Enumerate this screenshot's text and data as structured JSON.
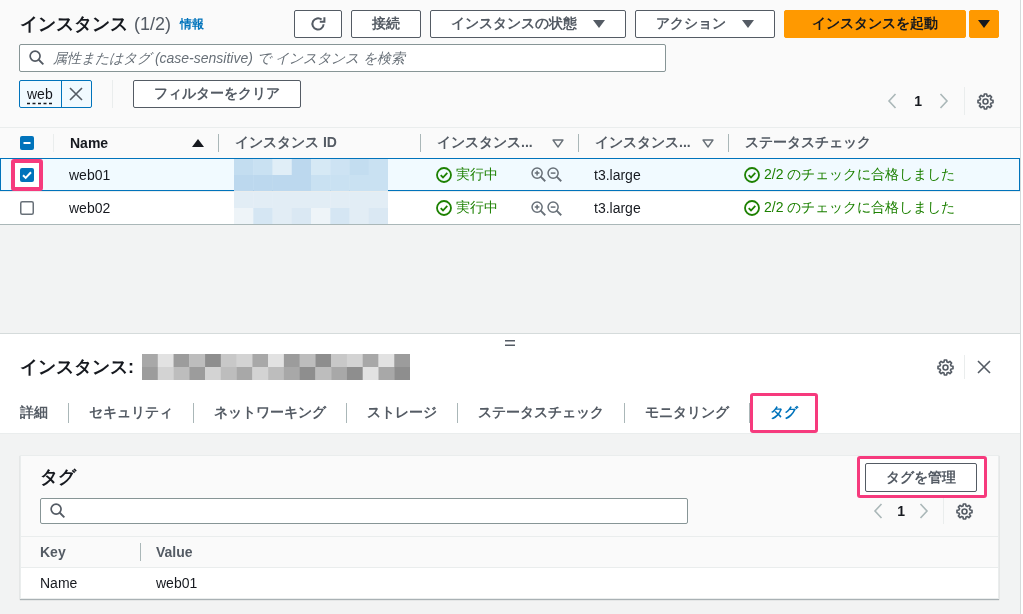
{
  "header": {
    "title": "インスタンス",
    "count": "(1/2)",
    "info_link": "情報"
  },
  "actions": [
    {
      "kind": "refresh"
    },
    {
      "kind": "button",
      "label": "接続"
    },
    {
      "kind": "dropdown",
      "label": "インスタンスの状態"
    },
    {
      "kind": "dropdown",
      "label": "アクション"
    },
    {
      "kind": "primary-split",
      "label": "インスタンスを起動"
    }
  ],
  "search": {
    "placeholder": "属性またはタグ (case-sensitive) で インスタンス を検索"
  },
  "filter_tokens": [
    {
      "label": "web"
    }
  ],
  "clear_filters_button": "フィルターをクリア",
  "pagination": {
    "page": "1"
  },
  "table": {
    "select_all": {
      "checked": false,
      "indeterminate": true
    },
    "columns": [
      {
        "label": "Name",
        "sorted": true,
        "filter": false
      },
      {
        "label": "インスタンス ID",
        "sorted": false,
        "filter": false
      },
      {
        "label": "インスタンス...",
        "sorted": false,
        "filter": true
      },
      {
        "label": "インスタンス...",
        "sorted": false,
        "filter": true
      },
      {
        "label": "ステータスチェック",
        "sorted": false,
        "filter": false
      }
    ],
    "rows": [
      {
        "selected": true,
        "highlighted": true,
        "name": "web01",
        "state": {
          "label": "実行中",
          "kind": "success"
        },
        "type": "t3.large",
        "status_check": {
          "label": "2/2 のチェックに合格しました",
          "kind": "success"
        }
      },
      {
        "selected": false,
        "highlighted": false,
        "name": "web02",
        "state": {
          "label": "実行中",
          "kind": "success"
        },
        "type": "t3.large",
        "status_check": {
          "label": "2/2 のチェックに合格しました",
          "kind": "success"
        }
      }
    ]
  },
  "details": {
    "title": "インスタンス:",
    "tabs": [
      {
        "label": "詳細",
        "selected": false,
        "highlighted": false
      },
      {
        "label": "セキュリティ",
        "selected": false,
        "highlighted": false
      },
      {
        "label": "ネットワーキング",
        "selected": false,
        "highlighted": false
      },
      {
        "label": "ストレージ",
        "selected": false,
        "highlighted": false
      },
      {
        "label": "ステータスチェック",
        "selected": false,
        "highlighted": false
      },
      {
        "label": "モニタリング",
        "selected": false,
        "highlighted": false
      },
      {
        "label": "タグ",
        "selected": true,
        "highlighted": true
      }
    ],
    "tags": {
      "title": "タグ",
      "manage_button": {
        "label": "タグを管理",
        "highlighted": true
      },
      "pagination": {
        "page": "1"
      },
      "columns": [
        "Key",
        "Value"
      ],
      "rows": [
        {
          "key": "Name",
          "value": "web01"
        }
      ]
    }
  }
}
